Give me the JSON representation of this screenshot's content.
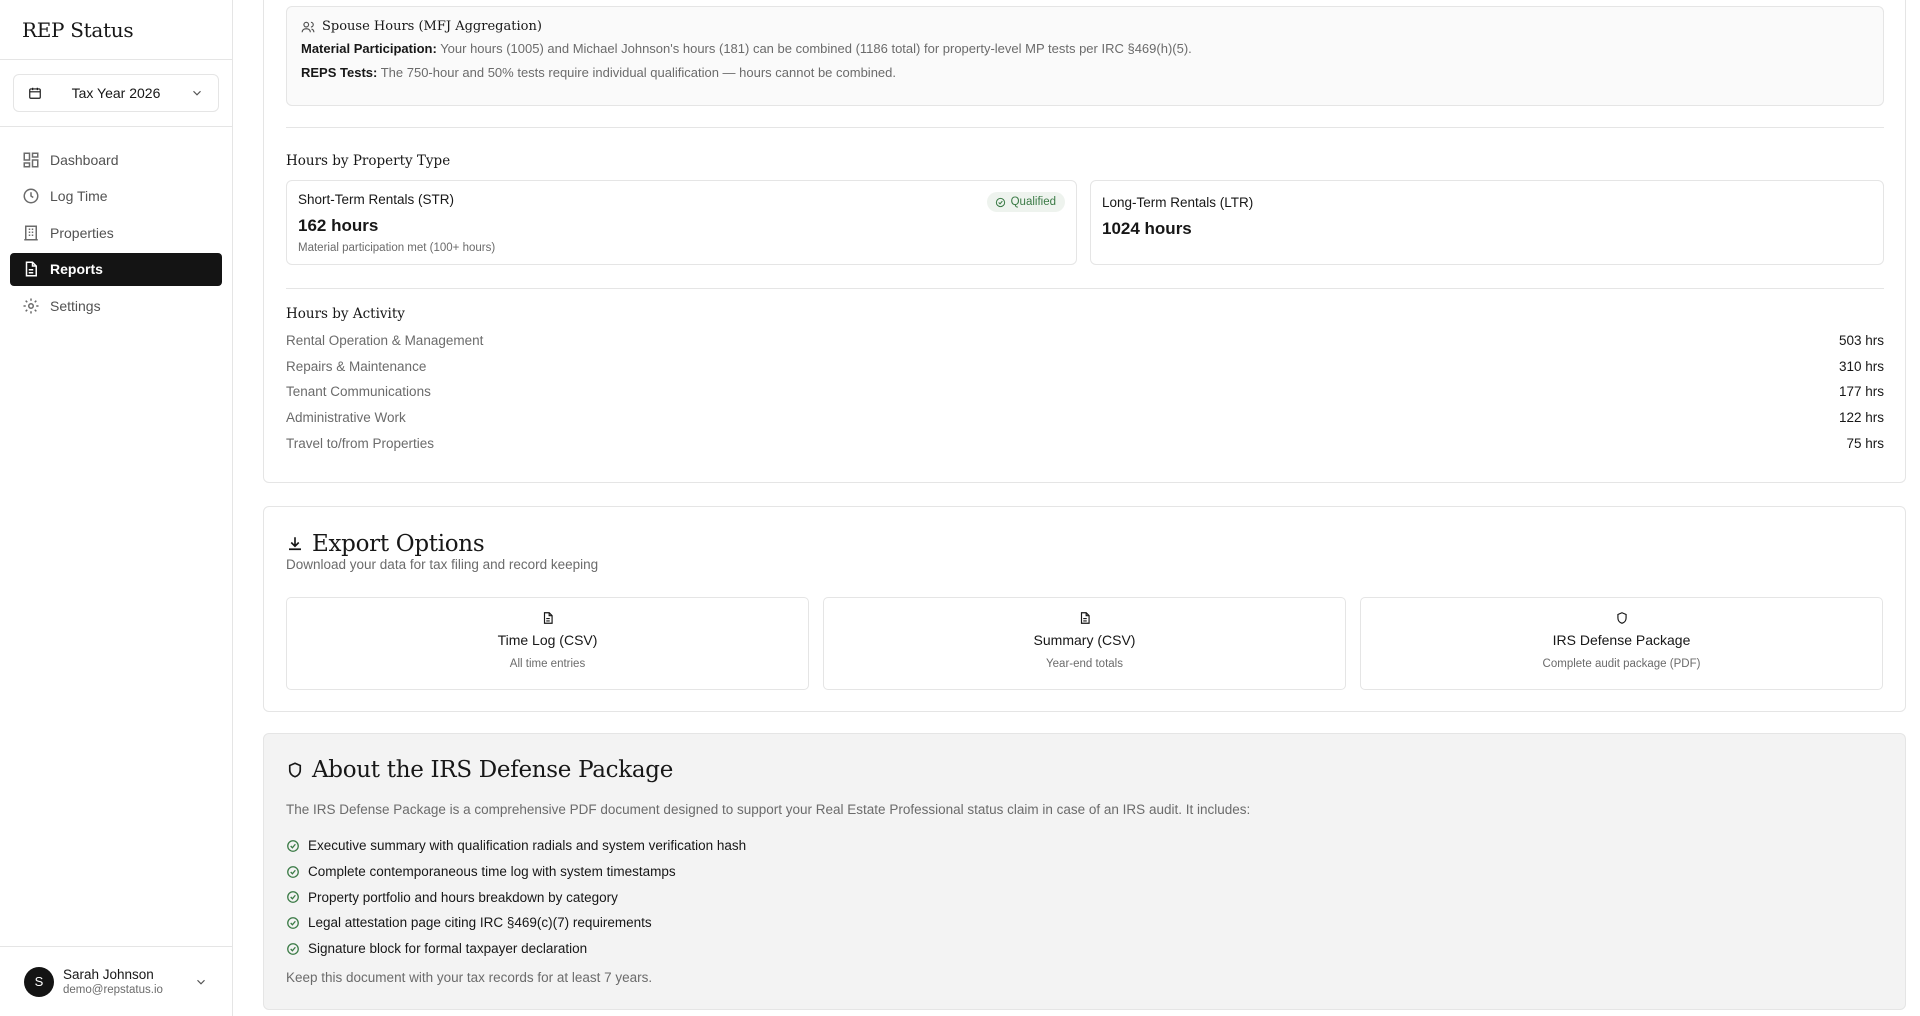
{
  "app": {
    "title": "REP Status"
  },
  "sidebar": {
    "tax_year": "Tax Year 2026",
    "nav": [
      {
        "label": "Dashboard",
        "icon": "dashboard-icon"
      },
      {
        "label": "Log Time",
        "icon": "clock-icon"
      },
      {
        "label": "Properties",
        "icon": "building-icon"
      },
      {
        "label": "Reports",
        "icon": "document-icon",
        "active": true
      },
      {
        "label": "Settings",
        "icon": "gear-icon"
      }
    ],
    "user": {
      "initial": "S",
      "name": "Sarah Johnson",
      "email": "demo@repstatus.io"
    }
  },
  "spouse": {
    "title": "Spouse Hours (MFJ Aggregation)",
    "mp_label": "Material Participation:",
    "mp_text": "Your hours (1005) and Michael Johnson's hours (181) can be combined (1186 total) for property-level MP tests per IRC §469(h)(5).",
    "reps_label": "REPS Tests:",
    "reps_text": "The 750-hour and 50% tests require individual qualification — hours cannot be combined."
  },
  "property_types": {
    "title": "Hours by Property Type",
    "str": {
      "name": "Short-Term Rentals (STR)",
      "hours": "162 hours",
      "note": "Material participation met (100+ hours)",
      "badge": "Qualified"
    },
    "ltr": {
      "name": "Long-Term Rentals (LTR)",
      "hours": "1024 hours"
    }
  },
  "activities": {
    "title": "Hours by Activity",
    "rows": [
      {
        "name": "Rental Operation & Management",
        "hours": "503 hrs"
      },
      {
        "name": "Repairs & Maintenance",
        "hours": "310 hrs"
      },
      {
        "name": "Tenant Communications",
        "hours": "177 hrs"
      },
      {
        "name": "Administrative Work",
        "hours": "122 hrs"
      },
      {
        "name": "Travel to/from Properties",
        "hours": "75 hrs"
      }
    ]
  },
  "export": {
    "title": "Export Options",
    "desc": "Download your data for tax filing and record keeping",
    "options": [
      {
        "title": "Time Log (CSV)",
        "sub": "All time entries",
        "icon": "file-icon"
      },
      {
        "title": "Summary (CSV)",
        "sub": "Year-end totals",
        "icon": "file-icon"
      },
      {
        "title": "IRS Defense Package",
        "sub": "Complete audit package (PDF)",
        "icon": "shield-icon"
      }
    ]
  },
  "about": {
    "title": "About the IRS Defense Package",
    "intro": "The IRS Defense Package is a comprehensive PDF document designed to support your Real Estate Professional status claim in case of an IRS audit. It includes:",
    "features": [
      "Executive summary with qualification radials and system verification hash",
      "Complete contemporaneous time log with system timestamps",
      "Property portfolio and hours breakdown by category",
      "Legal attestation page citing IRC §469(c)(7) requirements",
      "Signature block for formal taxpayer declaration"
    ],
    "footer": "Keep this document with your tax records for at least 7 years."
  },
  "colors": {
    "accent": "#141414",
    "success": "#3a7a45",
    "muted": "#6b6b6b",
    "border": "#e5e5e5"
  }
}
